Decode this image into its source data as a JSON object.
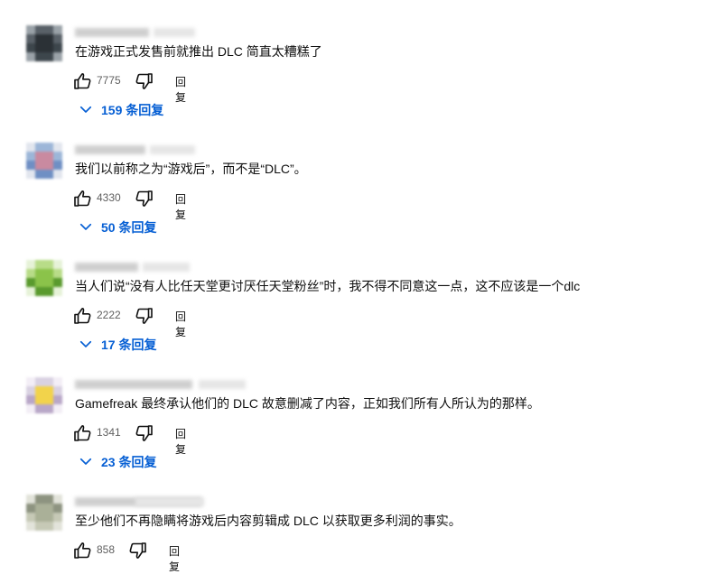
{
  "reply_label": "回复",
  "comments": [
    {
      "text": "在游戏正式发售前就推出 DLC 简直太糟糕了",
      "likes": "7775",
      "replies": "159 条回复"
    },
    {
      "text": "我们以前称之为“游戏后”，而不是“DLC”。",
      "likes": "4330",
      "replies": "50 条回复"
    },
    {
      "text": "当人们说“没有人比任天堂更讨厌任天堂粉丝”时，我不得不同意这一点，这不应该是一个dlc",
      "likes": "2222",
      "replies": "17 条回复"
    },
    {
      "text": "Gamefreak 最终承认他们的 DLC 故意删减了内容，正如我们所有人所认为的那样。",
      "likes": "1341",
      "replies": "23 条回复"
    },
    {
      "text": "至少他们不再隐瞒将游戏后内容剪辑成 DLC 以获取更多利润的事实。",
      "likes": "858"
    }
  ],
  "colors": {
    "link": "#065fd4",
    "secondary_text": "#606060",
    "avatars": [
      [
        "#2b3136",
        "#3d464c",
        "#596168",
        "#9aa2a8"
      ],
      [
        "#c98aa0",
        "#6f8fc4",
        "#9cb6d8",
        "#e2e6ee"
      ],
      [
        "#8bc34a",
        "#5a9a2e",
        "#b8dc88",
        "#e6f2d8"
      ],
      [
        "#f2d34b",
        "#b9a7c8",
        "#d9d2e2",
        "#f3eef6"
      ],
      [
        "#aab098",
        "#c6c9b6",
        "#8d9380",
        "#e2e3da"
      ]
    ]
  }
}
